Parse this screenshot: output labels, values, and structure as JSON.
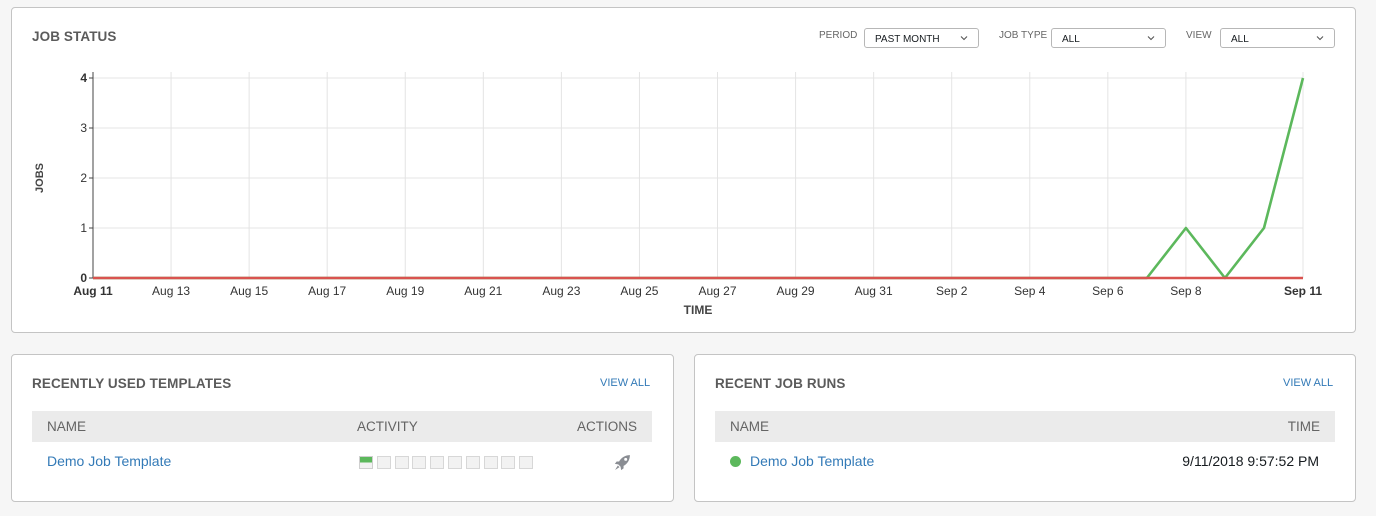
{
  "chart_panel": {
    "title": "JOB STATUS",
    "filters": [
      {
        "label": "PERIOD",
        "value": "PAST MONTH"
      },
      {
        "label": "JOB TYPE",
        "value": "ALL"
      },
      {
        "label": "VIEW",
        "value": "ALL"
      }
    ]
  },
  "chart_data": {
    "type": "line",
    "xlabel": "TIME",
    "ylabel": "JOBS",
    "ylim": [
      0,
      4
    ],
    "yticks": [
      "0",
      "1",
      "2",
      "3",
      "4"
    ],
    "xticks": [
      "Aug 11",
      "Aug 13",
      "Aug 15",
      "Aug 17",
      "Aug 19",
      "Aug 21",
      "Aug 23",
      "Aug 25",
      "Aug 27",
      "Aug 29",
      "Aug 31",
      "Sep 2",
      "Sep 4",
      "Sep 6",
      "Sep 8",
      "Sep 11"
    ],
    "x": [
      "Aug 11",
      "Aug 12",
      "Aug 13",
      "Aug 14",
      "Aug 15",
      "Aug 16",
      "Aug 17",
      "Aug 18",
      "Aug 19",
      "Aug 20",
      "Aug 21",
      "Aug 22",
      "Aug 23",
      "Aug 24",
      "Aug 25",
      "Aug 26",
      "Aug 27",
      "Aug 28",
      "Aug 29",
      "Aug 30",
      "Aug 31",
      "Sep 1",
      "Sep 2",
      "Sep 3",
      "Sep 4",
      "Sep 5",
      "Sep 6",
      "Sep 7",
      "Sep 8",
      "Sep 9",
      "Sep 10",
      "Sep 11"
    ],
    "grid": true,
    "series": [
      {
        "color": "#5cb85c",
        "values": [
          0,
          0,
          0,
          0,
          0,
          0,
          0,
          0,
          0,
          0,
          0,
          0,
          0,
          0,
          0,
          0,
          0,
          0,
          0,
          0,
          0,
          0,
          0,
          0,
          0,
          0,
          0,
          0,
          1,
          0,
          1,
          4
        ]
      },
      {
        "color": "#d9534f",
        "values": [
          0,
          0,
          0,
          0,
          0,
          0,
          0,
          0,
          0,
          0,
          0,
          0,
          0,
          0,
          0,
          0,
          0,
          0,
          0,
          0,
          0,
          0,
          0,
          0,
          0,
          0,
          0,
          0,
          0,
          0,
          0,
          0
        ]
      }
    ]
  },
  "templates_panel": {
    "title": "RECENTLY USED TEMPLATES",
    "view_all": "VIEW ALL",
    "columns": {
      "name": "NAME",
      "activity": "ACTIVITY",
      "actions": "ACTIONS"
    },
    "rows": [
      {
        "name": "Demo Job Template",
        "activity": [
          "successful",
          "none",
          "none",
          "none",
          "none",
          "none",
          "none",
          "none",
          "none",
          "none"
        ],
        "action_icon": "rocket-icon"
      }
    ]
  },
  "runs_panel": {
    "title": "RECENT JOB RUNS",
    "view_all": "VIEW ALL",
    "columns": {
      "name": "NAME",
      "time": "TIME"
    },
    "rows": [
      {
        "status": "successful",
        "name": "Demo Job Template",
        "time": "9/11/2018 9:57:52 PM"
      }
    ]
  },
  "colors": {
    "link": "#337ab7",
    "success": "#5cb85c",
    "failed": "#d9534f"
  }
}
